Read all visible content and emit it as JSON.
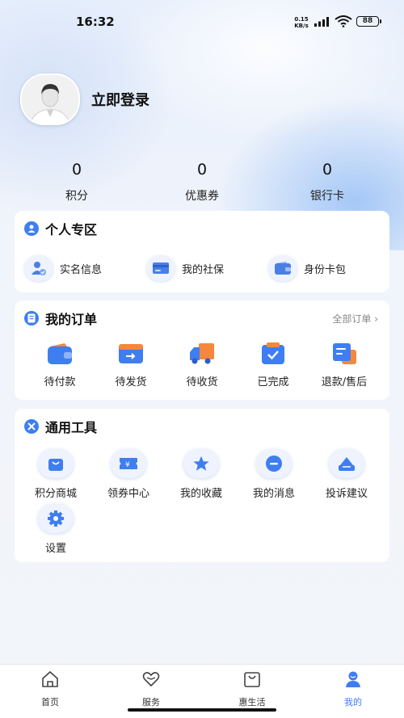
{
  "status_bar": {
    "time": "16:32",
    "net_speed_value": "0.15",
    "net_speed_unit": "KB/s",
    "battery": "88"
  },
  "profile": {
    "login_text": "立即登录"
  },
  "stats": [
    {
      "value": "0",
      "label": "积分"
    },
    {
      "value": "0",
      "label": "优惠券"
    },
    {
      "value": "0",
      "label": "银行卡"
    }
  ],
  "personal": {
    "title": "个人专区",
    "items": [
      {
        "label": "实名信息",
        "icon": "realname-icon"
      },
      {
        "label": "我的社保",
        "icon": "social-security-card-icon"
      },
      {
        "label": "身份卡包",
        "icon": "wallet-icon"
      }
    ]
  },
  "orders": {
    "title": "我的订单",
    "more": "全部订单 ›",
    "items": [
      {
        "label": "待付款",
        "icon": "wallet-icon"
      },
      {
        "label": "待发货",
        "icon": "card-transfer-icon"
      },
      {
        "label": "待收货",
        "icon": "truck-icon"
      },
      {
        "label": "已完成",
        "icon": "check-box-icon"
      },
      {
        "label": "退款/售后",
        "icon": "refund-doc-icon"
      }
    ]
  },
  "tools": {
    "title": "通用工具",
    "items": [
      {
        "label": "积分商城",
        "icon": "shopping-bag-icon"
      },
      {
        "label": "领券中心",
        "icon": "coupon-icon"
      },
      {
        "label": "我的收藏",
        "icon": "star-icon"
      },
      {
        "label": "我的消息",
        "icon": "message-icon"
      },
      {
        "label": "投诉建议",
        "icon": "feedback-icon"
      },
      {
        "label": "设置",
        "icon": "gear-icon"
      }
    ]
  },
  "tabbar": {
    "items": [
      {
        "label": "首页",
        "icon": "home-icon"
      },
      {
        "label": "服务",
        "icon": "heart-icon"
      },
      {
        "label": "惠生活",
        "icon": "bag-icon"
      },
      {
        "label": "我的",
        "icon": "user-icon"
      }
    ],
    "active": "我的"
  },
  "colors": {
    "accent": "#3f7ef0",
    "background": "#f3f5f9",
    "card": "#ffffff",
    "orange": "#f5883c"
  }
}
